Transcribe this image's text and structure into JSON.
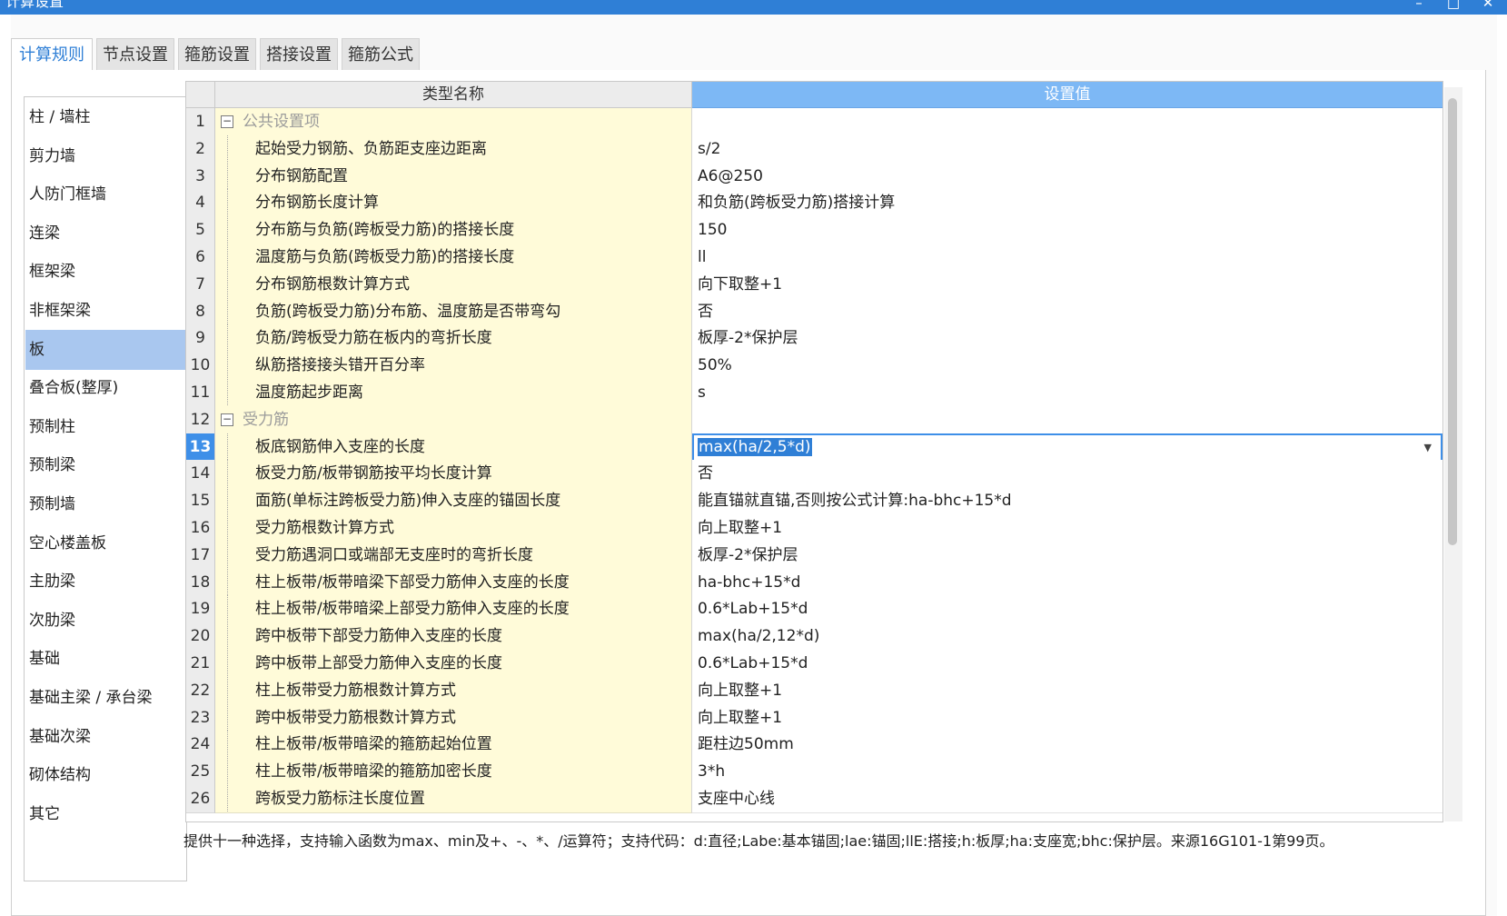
{
  "window": {
    "title": "计算设置",
    "controls": [
      "minimize",
      "maximize",
      "close"
    ]
  },
  "tabs": [
    {
      "label": "计算规则",
      "active": true
    },
    {
      "label": "节点设置",
      "active": false
    },
    {
      "label": "箍筋设置",
      "active": false
    },
    {
      "label": "搭接设置",
      "active": false
    },
    {
      "label": "箍筋公式",
      "active": false
    }
  ],
  "left_list": {
    "selected": "板",
    "items": [
      "柱 / 墙柱",
      "剪力墙",
      "人防门框墙",
      "连梁",
      "框架梁",
      "非框架梁",
      "板",
      "叠合板(整厚)",
      "预制柱",
      "预制梁",
      "预制墙",
      "空心楼盖板",
      "主肋梁",
      "次肋梁",
      "基础",
      "基础主梁 / 承台梁",
      "基础次梁",
      "砌体结构",
      "其它"
    ]
  },
  "grid": {
    "columns": {
      "name": "类型名称",
      "value": "设置值"
    },
    "current_row": 13,
    "rows": [
      {
        "no": "1",
        "group": true,
        "name": "公共设置项",
        "value": ""
      },
      {
        "no": "2",
        "name": "起始受力钢筋、负筋距支座边距离",
        "value": "s/2"
      },
      {
        "no": "3",
        "name": "分布钢筋配置",
        "value": "A6@250"
      },
      {
        "no": "4",
        "name": "分布钢筋长度计算",
        "value": "和负筋(跨板受力筋)搭接计算"
      },
      {
        "no": "5",
        "name": "分布筋与负筋(跨板受力筋)的搭接长度",
        "value": "150"
      },
      {
        "no": "6",
        "name": "温度筋与负筋(跨板受力筋)的搭接长度",
        "value": "ll"
      },
      {
        "no": "7",
        "name": "分布钢筋根数计算方式",
        "value": "向下取整+1"
      },
      {
        "no": "8",
        "name": "负筋(跨板受力筋)分布筋、温度筋是否带弯勾",
        "value": "否"
      },
      {
        "no": "9",
        "name": "负筋/跨板受力筋在板内的弯折长度",
        "value": "板厚-2*保护层"
      },
      {
        "no": "10",
        "name": "纵筋搭接接头错开百分率",
        "value": "50%"
      },
      {
        "no": "11",
        "name": "温度筋起步距离",
        "value": "s"
      },
      {
        "no": "12",
        "group": true,
        "name": "受力筋",
        "value": ""
      },
      {
        "no": "13",
        "name": "板底钢筋伸入支座的长度",
        "value": "max(ha/2,5*d)"
      },
      {
        "no": "14",
        "name": "板受力筋/板带钢筋按平均长度计算",
        "value": "否"
      },
      {
        "no": "15",
        "name": "面筋(单标注跨板受力筋)伸入支座的锚固长度",
        "value": "能直锚就直锚,否则按公式计算:ha-bhc+15*d"
      },
      {
        "no": "16",
        "name": "受力筋根数计算方式",
        "value": "向上取整+1"
      },
      {
        "no": "17",
        "name": "受力筋遇洞口或端部无支座时的弯折长度",
        "value": "板厚-2*保护层"
      },
      {
        "no": "18",
        "name": "柱上板带/板带暗梁下部受力筋伸入支座的长度",
        "value": "ha-bhc+15*d"
      },
      {
        "no": "19",
        "name": "柱上板带/板带暗梁上部受力筋伸入支座的长度",
        "value": "0.6*Lab+15*d"
      },
      {
        "no": "20",
        "name": "跨中板带下部受力筋伸入支座的长度",
        "value": "max(ha/2,12*d)"
      },
      {
        "no": "21",
        "name": "跨中板带上部受力筋伸入支座的长度",
        "value": "0.6*Lab+15*d"
      },
      {
        "no": "22",
        "name": "柱上板带受力筋根数计算方式",
        "value": "向上取整+1"
      },
      {
        "no": "23",
        "name": "跨中板带受力筋根数计算方式",
        "value": "向上取整+1"
      },
      {
        "no": "24",
        "name": "柱上板带/板带暗梁的箍筋起始位置",
        "value": "距柱边50mm"
      },
      {
        "no": "25",
        "name": "柱上板带/板带暗梁的箍筋加密长度",
        "value": "3*h"
      },
      {
        "no": "26",
        "name": "跨板受力筋标注长度位置",
        "value": "支座中心线"
      }
    ]
  },
  "hint": "提供十一种选择，支持输入函数为max、min及+、-、*、/运算符；支持代码：d:直径;Labe:基本锚固;lae:锚固;llE:搭接;h:板厚;ha:支座宽;bhc:保护层。来源16G101-1第99页。",
  "colors": {
    "titlebar": "#2f7fd6",
    "header_value": "#7db8f5",
    "selected_item": "#a9c7ef",
    "name_cell": "#fffbd9"
  }
}
